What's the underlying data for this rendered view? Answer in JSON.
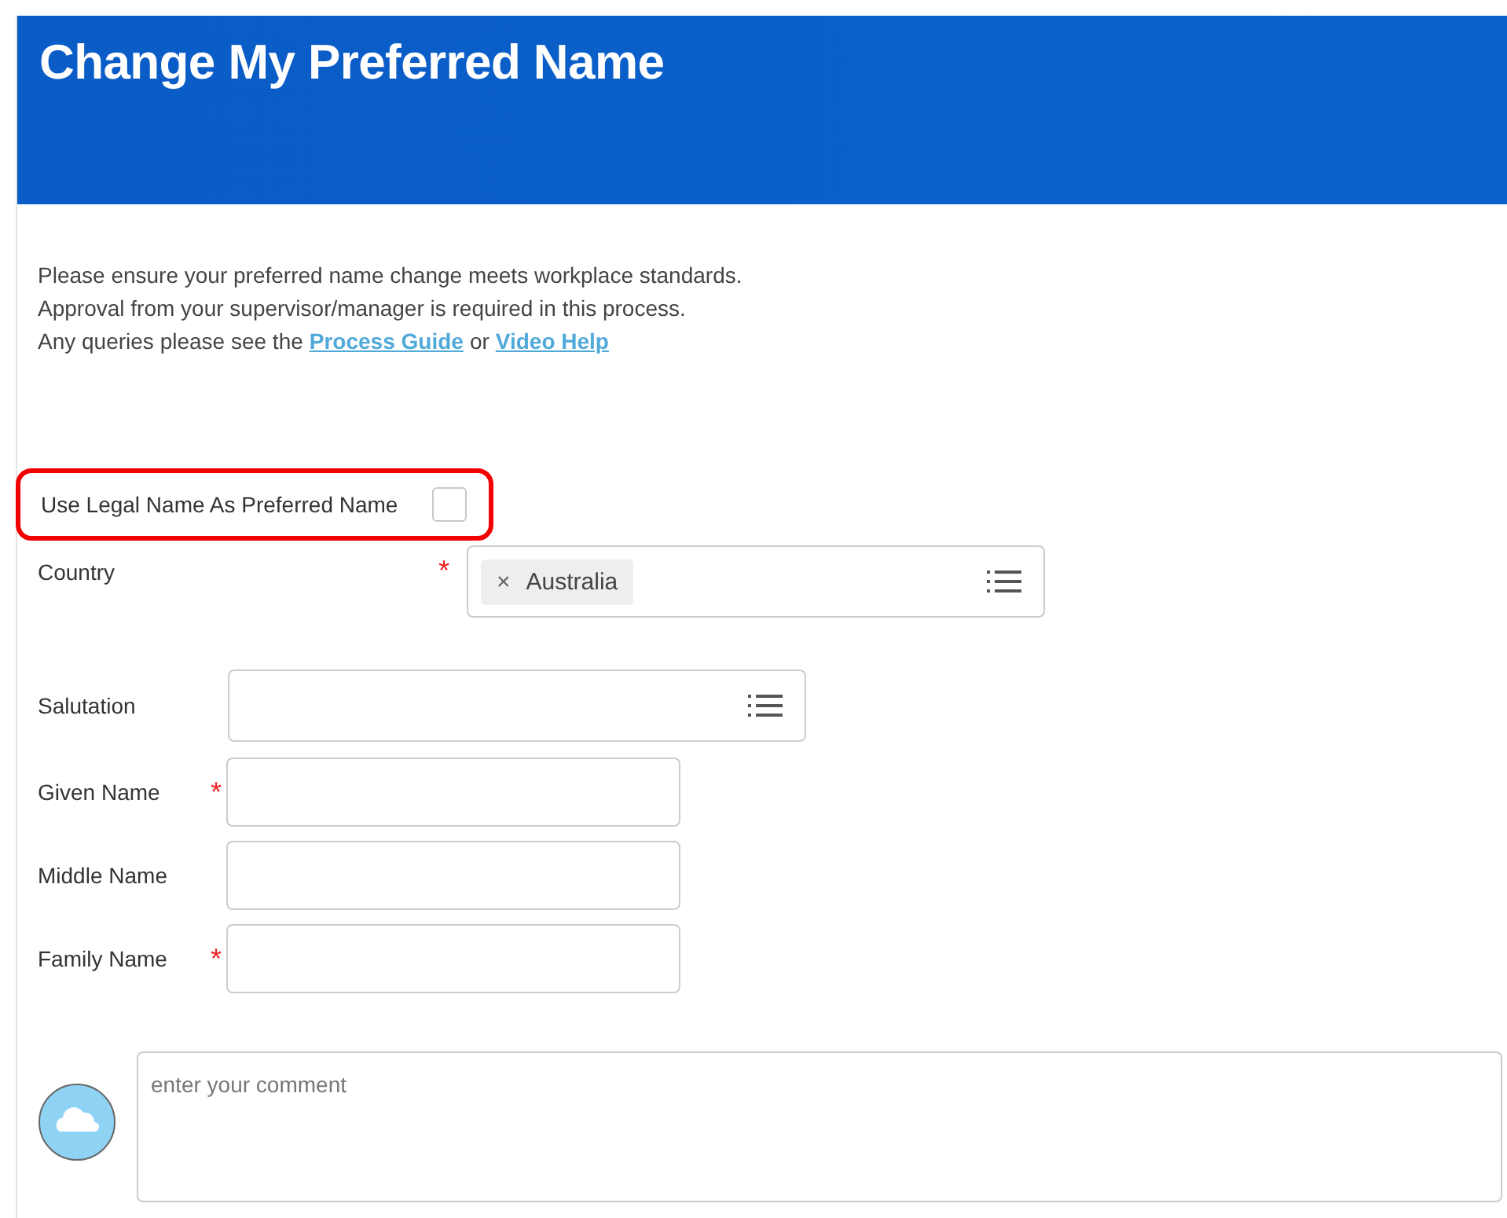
{
  "header": {
    "title": "Change My Preferred Name"
  },
  "intro": {
    "lines": [
      "Please ensure your preferred name change meets workplace standards.",
      "Approval from your supervisor/manager is required in this process."
    ],
    "links_prefix": "Any queries please see the",
    "links": [
      {
        "text": "Process Guide"
      },
      {
        "text": "Video Help"
      }
    ],
    "links_joiner": "or"
  },
  "legal_name_option": {
    "label": "Use Legal Name As Preferred Name",
    "checked": false,
    "highlighted": true
  },
  "fields": [
    {
      "kind": "select",
      "label": "Country",
      "required_mark": "*",
      "tokens": [
        {
          "remove": "×",
          "text": "Australia"
        }
      ]
    },
    {
      "kind": "select",
      "label": "Salutation"
    },
    {
      "kind": "text",
      "label": "Given Name",
      "required_mark": "*"
    },
    {
      "kind": "text",
      "label": "Middle Name"
    },
    {
      "kind": "text",
      "label": "Family Name",
      "required_mark": "*"
    }
  ],
  "comment": {
    "placeholder": "enter your comment"
  }
}
